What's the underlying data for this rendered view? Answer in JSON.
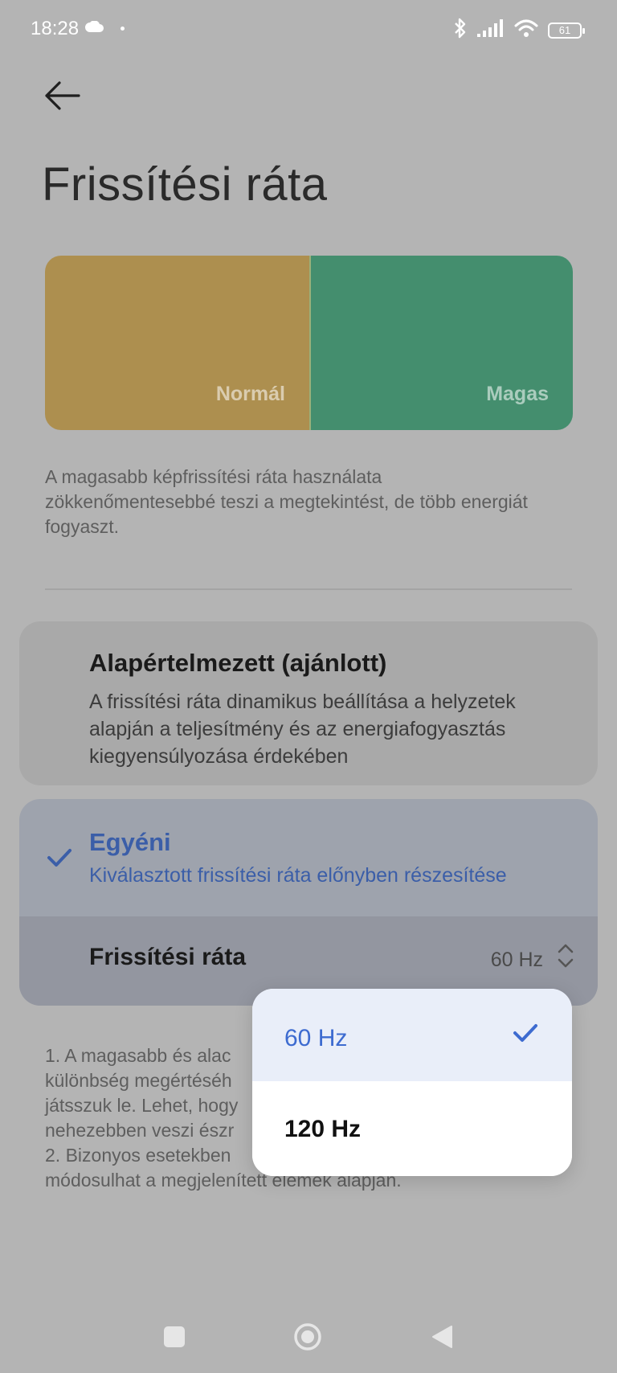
{
  "status_bar": {
    "time": "18:28",
    "battery": "61",
    "icons": [
      "cloud-icon",
      "bluetooth-icon",
      "signal-icon",
      "wifi-icon",
      "battery-icon"
    ]
  },
  "header": {
    "back_icon": "arrow-left-icon",
    "title": "Frissítési ráta"
  },
  "preview": {
    "normal_label": "Normál",
    "high_label": "Magas",
    "normal_color": "#ad8f4f",
    "high_color": "#448e6e"
  },
  "description": "A magasabb képfrissítési ráta használata zökkenőmentesebbé teszi a megtekintést, de több energiát fogyaszt.",
  "options": {
    "default": {
      "title": "Alapértelmezett (ajánlott)",
      "subtitle": "A frissítési ráta dinamikus beállítása a helyzetek alapján a teljesítmény és az energiafogyasztás kiegyensúlyozása érdekében"
    },
    "custom": {
      "title": "Egyéni",
      "subtitle": "Kiválasztott frissítési ráta előnyben részesítése",
      "selected": true,
      "accent_color": "#3b5ea8"
    }
  },
  "rate_setting": {
    "label": "Frissítési ráta",
    "value": "60 Hz"
  },
  "notes": {
    "line1": "1. A magasabb és alac",
    "line2": "különbség megértéséh",
    "line3": "játsszuk le. Lehet, hogy",
    "line4": "nehezebben veszi észr",
    "line5": "2. Bizonyos esetekben",
    "line6": "módosulhat a megjelenített elemek alapján."
  },
  "popup": {
    "options": [
      {
        "label": "60 Hz",
        "selected": true
      },
      {
        "label": "120 Hz",
        "selected": false
      }
    ]
  },
  "nav_bar": {
    "icons": [
      "recents-square-icon",
      "home-circle-icon",
      "back-triangle-icon"
    ]
  }
}
